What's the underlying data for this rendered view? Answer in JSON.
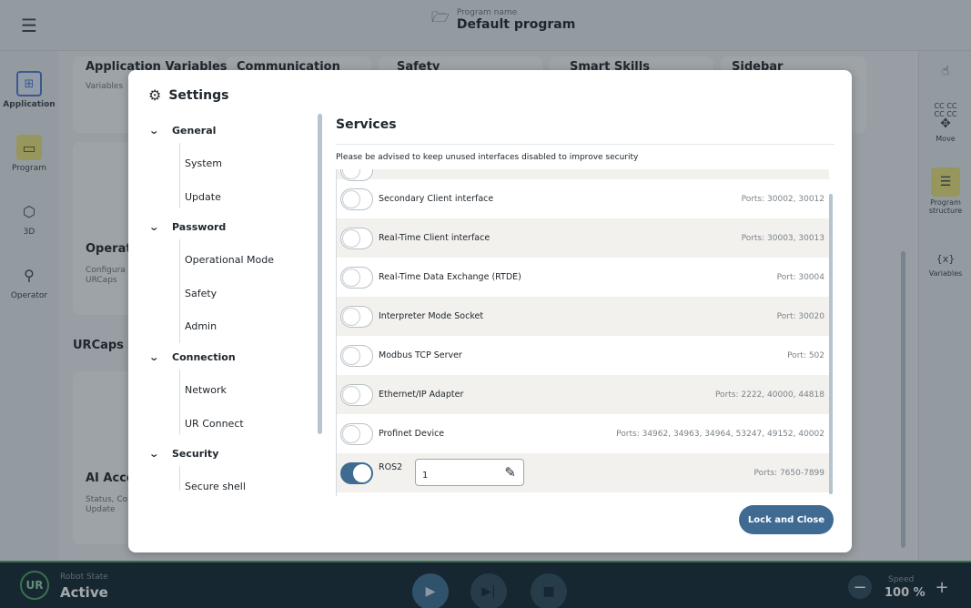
{
  "topbar": {
    "program_name_label": "Program name",
    "program_name": "Default program"
  },
  "left_rail": [
    {
      "label": "Application",
      "icon": "grid-icon"
    },
    {
      "label": "Program",
      "icon": "program-icon"
    },
    {
      "label": "3D",
      "icon": "cube-icon"
    },
    {
      "label": "Operator",
      "icon": "person-icon"
    }
  ],
  "right_rail": [
    {
      "label": "",
      "icon": "hand-icon"
    },
    {
      "label": "CC CC\nCC CC",
      "icon": ""
    },
    {
      "label": "Move",
      "icon": "move-icon"
    },
    {
      "label": "Program structure",
      "icon": "list-icon"
    },
    {
      "label": "Variables",
      "icon": "variables-icon",
      "glyph": "{x}"
    }
  ],
  "background": {
    "cards": [
      {
        "title": "Application Variables",
        "sub": "Variables"
      },
      {
        "title": "Communication",
        "sub": ""
      },
      {
        "title": "Safety",
        "sub": ""
      },
      {
        "title": "Smart Skills",
        "sub": ""
      },
      {
        "title": "Sidebar",
        "sub": ""
      },
      {
        "title": "Operat",
        "sub": "Configura\nURCaps"
      },
      {
        "title": "AI Acce",
        "sub": "Status, Co\nUpdate"
      }
    ],
    "section_urcaps": "URCaps"
  },
  "dialog": {
    "title": "Settings",
    "nav": [
      {
        "group": "General",
        "items": [
          "System",
          "Update"
        ]
      },
      {
        "group": "Password",
        "items": [
          "Operational Mode",
          "Safety",
          "Admin"
        ]
      },
      {
        "group": "Connection",
        "items": [
          "Network",
          "UR Connect"
        ]
      },
      {
        "group": "Security",
        "items": [
          "Secure shell"
        ]
      }
    ],
    "content_title": "Services",
    "note": "Please be advised to keep unused interfaces disabled to improve security",
    "services": [
      {
        "label": "Secondary Client interface",
        "ports": "Ports: 30002, 30012",
        "enabled": false
      },
      {
        "label": "Real-Time Client interface",
        "ports": "Ports: 30003, 30013",
        "enabled": false
      },
      {
        "label": "Real-Time Data Exchange (RTDE)",
        "ports": "Port: 30004",
        "enabled": false
      },
      {
        "label": "Interpreter Mode Socket",
        "ports": "Port: 30020",
        "enabled": false
      },
      {
        "label": "Modbus TCP Server",
        "ports": "Port: 502",
        "enabled": false
      },
      {
        "label": "Ethernet/IP Adapter",
        "ports": "Ports: 2222, 40000, 44818",
        "enabled": false
      },
      {
        "label": "Profinet Device",
        "ports": "Ports: 34962, 34963, 34964, 53247, 49152, 40002",
        "enabled": false
      },
      {
        "label": "ROS2",
        "ports": "Ports: 7650-7899",
        "enabled": true,
        "input_value": "1"
      }
    ],
    "lock_button": "Lock and Close"
  },
  "bottombar": {
    "robot_state_label": "Robot State",
    "robot_state": "Active",
    "logo": "UR",
    "speed_label": "Speed",
    "speed_value": "100 %"
  },
  "colors": {
    "accent": "#3f6b93",
    "active_green": "#4ca162",
    "bottombar": "#112733"
  }
}
